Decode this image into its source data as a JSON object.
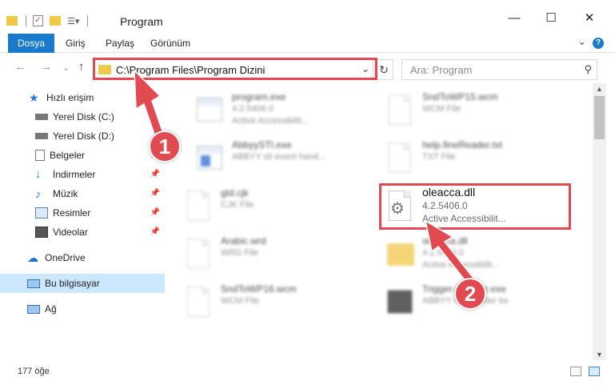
{
  "window": {
    "title": "Program",
    "minimize": "—",
    "maximize": "☐",
    "close": "✕"
  },
  "ribbon": {
    "tabs": [
      "Dosya",
      "Giriş",
      "Paylaş",
      "Görünüm"
    ]
  },
  "nav": {
    "back": "←",
    "forward": "→",
    "recent": "⌄",
    "up": "↑",
    "address": "C:\\Program Files\\Program Dizini",
    "search_placeholder": "Ara: Program"
  },
  "sidebar": {
    "items": [
      {
        "label": "Hızlı erişim",
        "icon": "star-icon"
      },
      {
        "label": "Yerel Disk (C:)",
        "icon": "drive-icon"
      },
      {
        "label": "Yerel Disk (D:)",
        "icon": "drive-icon"
      },
      {
        "label": "Belgeler",
        "icon": "documents-icon"
      },
      {
        "label": "İndirmeler",
        "icon": "download-icon"
      },
      {
        "label": "Müzik",
        "icon": "music-icon"
      },
      {
        "label": "Resimler",
        "icon": "pictures-icon"
      },
      {
        "label": "Videolar",
        "icon": "videos-icon"
      },
      {
        "label": "OneDrive",
        "icon": "cloud-icon"
      },
      {
        "label": "Bu bilgisayar",
        "icon": "computer-icon"
      },
      {
        "label": "Ağ",
        "icon": "network-icon"
      }
    ]
  },
  "files": [
    {
      "name": "program.exe",
      "sub1": "4.2.5406.0",
      "sub2": "Active Accessibilit..."
    },
    {
      "name": "SndToWP15.wcm",
      "sub1": "WCM File",
      "sub2": ""
    },
    {
      "name": "AbbyySTI.exe",
      "sub1": "ABBYY sti event hand...",
      "sub2": ""
    },
    {
      "name": "help.fineReader.txt",
      "sub1": "TXT File",
      "sub2": ""
    },
    {
      "name": "gtd.cjk",
      "sub1": "CJK File",
      "sub2": ""
    },
    {
      "name": "oleacca.dll",
      "sub1": "4.2.5406.0",
      "sub2": "Active Accessibilit..."
    },
    {
      "name": "Arabic.wrd",
      "sub1": "WRD File",
      "sub2": ""
    },
    {
      "name": "oleacca.dll",
      "sub1": "4.2.5406.0",
      "sub2": "Active Accessibilit..."
    },
    {
      "name": "SndToWP16.wcm",
      "sub1": "WCM File",
      "sub2": ""
    },
    {
      "name": "Trigger-installer.exe",
      "sub1": "ABBYY Finereader bs",
      "sub2": ""
    }
  ],
  "status": {
    "count": "177 öğe"
  },
  "annotations": {
    "step1": "1",
    "step2": "2",
    "color": "#e04a50"
  }
}
